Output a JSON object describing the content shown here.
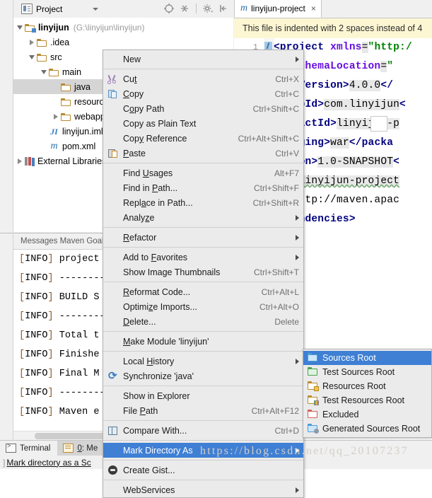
{
  "project_panel": {
    "title": "Project",
    "icon": "project-icon",
    "toolbar_icons": [
      "locate-icon",
      "collapse-all-icon",
      "settings-gear-icon",
      "hide-icon"
    ],
    "tree": [
      {
        "indent": 0,
        "twist": "open",
        "icon": "folder-module-icon",
        "label": "linyijun",
        "bold": true,
        "path": "(G:\\linyijun\\linyijun)"
      },
      {
        "indent": 1,
        "twist": "closed",
        "icon": "folder-icon",
        "label": ".idea",
        "bold": false,
        "path": ""
      },
      {
        "indent": 1,
        "twist": "open",
        "icon": "folder-icon",
        "label": "src",
        "bold": false,
        "path": ""
      },
      {
        "indent": 2,
        "twist": "open",
        "icon": "folder-icon",
        "label": "main",
        "bold": false,
        "path": ""
      },
      {
        "indent": 3,
        "twist": "none",
        "icon": "folder-icon",
        "label": "java",
        "bold": false,
        "path": "",
        "selected": true
      },
      {
        "indent": 3,
        "twist": "none",
        "icon": "folder-icon",
        "label": "resources",
        "bold": false,
        "path": ""
      },
      {
        "indent": 3,
        "twist": "closed",
        "icon": "folder-icon",
        "label": "webapp",
        "bold": false,
        "path": ""
      },
      {
        "indent": 2,
        "twist": "none",
        "icon": "iml-file-icon",
        "label": "linyijun.iml",
        "bold": false,
        "path": ""
      },
      {
        "indent": 2,
        "twist": "none",
        "icon": "maven-file-icon",
        "label": "pom.xml",
        "bold": false,
        "path": ""
      },
      {
        "indent": 0,
        "twist": "closed",
        "icon": "libraries-icon",
        "label": "External Libraries",
        "bold": false,
        "path": ""
      }
    ]
  },
  "editor": {
    "tab": {
      "label": "linyijun-project",
      "icon": "maven-file-icon",
      "close": "×"
    },
    "notification": "This file is indented with 2 spaces instead of 4",
    "line_number": "1",
    "lines": [
      {
        "segments": [
          {
            "t": "<project",
            "c": "tag"
          },
          {
            "t": " xmlns",
            "c": "attr"
          },
          {
            "t": "=",
            "c": "text"
          },
          {
            "t": "\"http:/",
            "c": "val"
          }
        ]
      },
      {
        "segments": [
          {
            "t": "si:schemaLocation",
            "c": "attr"
          },
          {
            "t": "=",
            "c": "text"
          },
          {
            "t": "\"",
            "c": "val"
          }
        ]
      },
      {
        "segments": [
          {
            "t": "odelVersion>",
            "c": "tag"
          },
          {
            "t": "4.0.0",
            "c": "text"
          },
          {
            "t": "</",
            "c": "tag"
          }
        ]
      },
      {
        "segments": [
          {
            "t": "groupId>",
            "c": "tag"
          },
          {
            "t": "com.linyijun",
            "c": "text"
          },
          {
            "t": "<",
            "c": "tag"
          }
        ]
      },
      {
        "segments": [
          {
            "t": "rtifactId>",
            "c": "tag"
          },
          {
            "t": "linyijun-p",
            "c": "text"
          }
        ]
      },
      {
        "segments": [
          {
            "t": "ackaging>",
            "c": "tag"
          },
          {
            "t": "war",
            "c": "text"
          },
          {
            "t": "</packa",
            "c": "tag"
          }
        ]
      },
      {
        "segments": [
          {
            "t": "ersion>",
            "c": "tag"
          },
          {
            "t": "1.0-SNAPSHOT",
            "c": "text"
          },
          {
            "t": "<",
            "c": "tag"
          }
        ]
      },
      {
        "segments": [
          {
            "t": "ame>",
            "c": "tag"
          },
          {
            "t": "linyijun-project",
            "c": "text"
          }
        ]
      },
      {
        "segments": [
          {
            "t": "rl>",
            "c": "tag"
          },
          {
            "t": "http://maven.apac",
            "c": "text"
          }
        ]
      },
      {
        "segments": [
          {
            "t": "lependencies>",
            "c": "tag"
          }
        ]
      }
    ]
  },
  "messages_panel": {
    "title": "Messages Maven Goal",
    "lines": [
      "[INFO] project",
      "[INFO] --------",
      "[INFO] BUILD S",
      "[INFO] --------",
      "[INFO] Total t",
      "[INFO] Finishe",
      "[INFO] Final M",
      "[INFO] --------",
      "[INFO] Maven e"
    ]
  },
  "bottom_tabs": [
    {
      "label": "Terminal",
      "icon": "terminal-icon",
      "active": false,
      "underline": ""
    },
    {
      "label": "0: Me",
      "icon": "messages-icon",
      "active": true,
      "underline": "0"
    }
  ],
  "status_bar": {
    "pipe": "]",
    "text": "Mark directory as a Sc"
  },
  "context_menu": {
    "items": [
      {
        "label": "New",
        "accel": "",
        "icon": "",
        "submenu": true,
        "mnemonic": ""
      },
      {
        "separator": true
      },
      {
        "label": "Cut",
        "accel": "Ctrl+X",
        "icon": "cut-icon",
        "mnemonic": "t"
      },
      {
        "label": "Copy",
        "accel": "Ctrl+C",
        "icon": "copy-icon",
        "mnemonic": "C"
      },
      {
        "label": "Copy Path",
        "accel": "Ctrl+Shift+C",
        "icon": "",
        "mnemonic": "o"
      },
      {
        "label": "Copy as Plain Text",
        "accel": "",
        "icon": "",
        "mnemonic": ""
      },
      {
        "label": "Copy Reference",
        "accel": "Ctrl+Alt+Shift+C",
        "icon": "",
        "mnemonic": "y"
      },
      {
        "label": "Paste",
        "accel": "Ctrl+V",
        "icon": "paste-icon",
        "mnemonic": "P"
      },
      {
        "separator": true
      },
      {
        "label": "Find Usages",
        "accel": "Alt+F7",
        "icon": "",
        "mnemonic": "U"
      },
      {
        "label": "Find in Path...",
        "accel": "Ctrl+Shift+F",
        "icon": "",
        "mnemonic": "P"
      },
      {
        "label": "Replace in Path...",
        "accel": "Ctrl+Shift+R",
        "icon": "",
        "mnemonic": "a"
      },
      {
        "label": "Analyze",
        "accel": "",
        "icon": "",
        "submenu": true,
        "mnemonic": "z"
      },
      {
        "separator": true
      },
      {
        "label": "Refactor",
        "accel": "",
        "icon": "",
        "submenu": true,
        "mnemonic": "R"
      },
      {
        "separator": true
      },
      {
        "label": "Add to Favorites",
        "accel": "",
        "icon": "",
        "submenu": true,
        "mnemonic": "F"
      },
      {
        "label": "Show Image Thumbnails",
        "accel": "Ctrl+Shift+T",
        "icon": "",
        "mnemonic": ""
      },
      {
        "separator": true
      },
      {
        "label": "Reformat Code...",
        "accel": "Ctrl+Alt+L",
        "icon": "",
        "mnemonic": "R"
      },
      {
        "label": "Optimize Imports...",
        "accel": "Ctrl+Alt+O",
        "icon": "",
        "mnemonic": "z"
      },
      {
        "label": "Delete...",
        "accel": "Delete",
        "icon": "",
        "mnemonic": "D"
      },
      {
        "separator": true
      },
      {
        "label": "Make Module 'linyijun'",
        "accel": "",
        "icon": "",
        "mnemonic": "M"
      },
      {
        "separator": true
      },
      {
        "label": "Local History",
        "accel": "",
        "icon": "",
        "submenu": true,
        "mnemonic": "H"
      },
      {
        "label": "Synchronize 'java'",
        "accel": "",
        "icon": "sync-icon",
        "mnemonic": ""
      },
      {
        "separator": true
      },
      {
        "label": "Show in Explorer",
        "accel": "",
        "icon": "",
        "mnemonic": ""
      },
      {
        "label": "File Path",
        "accel": "Ctrl+Alt+F12",
        "icon": "",
        "mnemonic": "P"
      },
      {
        "separator": true
      },
      {
        "label": "Compare With...",
        "accel": "Ctrl+D",
        "icon": "compare-icon",
        "mnemonic": ""
      },
      {
        "separator": true
      },
      {
        "label": "Mark Directory As",
        "accel": "",
        "icon": "",
        "submenu": true,
        "selected": true,
        "mnemonic": ""
      },
      {
        "separator": true
      },
      {
        "label": "Create Gist...",
        "accel": "",
        "icon": "gist-icon",
        "mnemonic": ""
      },
      {
        "separator": true
      },
      {
        "label": "WebServices",
        "accel": "",
        "icon": "",
        "submenu": true,
        "mnemonic": ""
      }
    ]
  },
  "submenu": {
    "items": [
      {
        "label": "Sources Root",
        "icon": "folder-blue-icon",
        "selected": true
      },
      {
        "label": "Test Sources Root",
        "icon": "folder-green-icon",
        "selected": false
      },
      {
        "label": "Resources Root",
        "icon": "folder-resources-icon",
        "selected": false
      },
      {
        "label": "Test Resources Root",
        "icon": "folder-test-resources-icon",
        "selected": false
      },
      {
        "label": "Excluded",
        "icon": "folder-red-icon",
        "selected": false
      },
      {
        "label": "Generated Sources Root",
        "icon": "folder-generated-icon",
        "selected": false
      }
    ]
  },
  "watermark": "https://blog.csdn.net/qq_20107237",
  "colors": {
    "menu_bg": "#ebebeb",
    "menu_selected": "#3f7fd4",
    "tree_selected": "#d5d5d5",
    "notification_bg": "#fdf6d3",
    "xml_tag": "#000080",
    "xml_attr": "#660ee0",
    "xml_value": "#008000"
  }
}
